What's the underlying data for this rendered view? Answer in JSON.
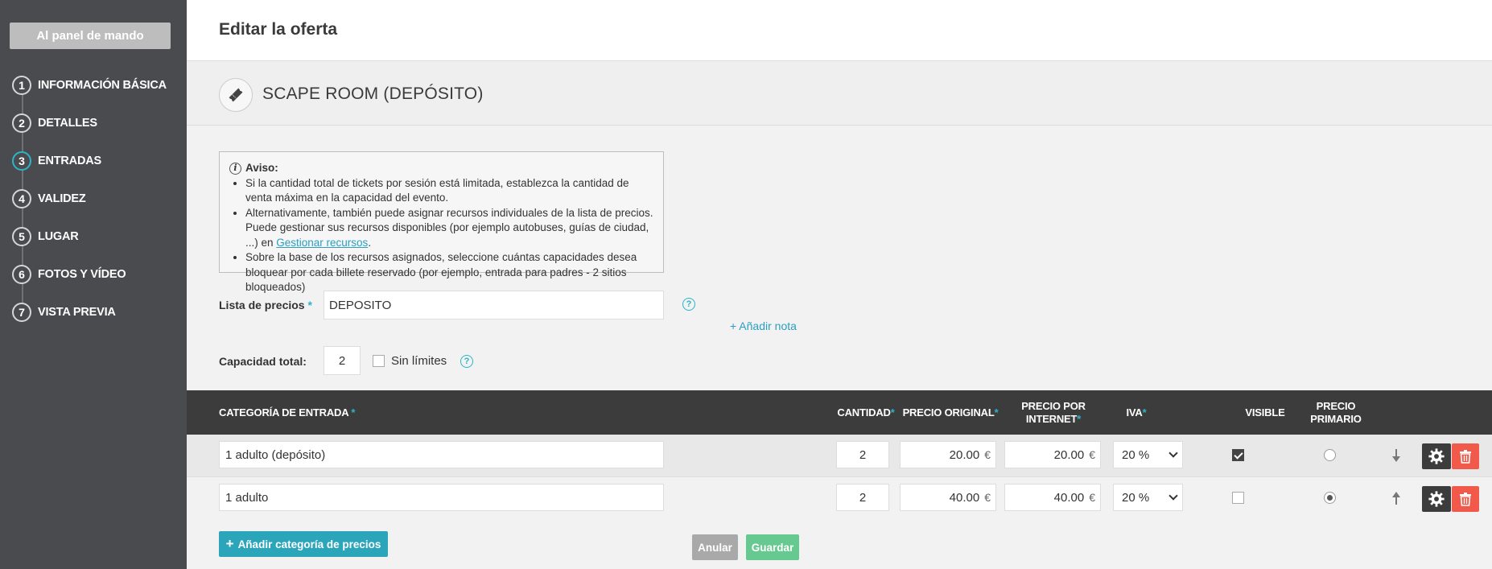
{
  "sidebar": {
    "dashboard_button": "Al panel de mando",
    "steps": [
      {
        "num": "1",
        "label": "INFORMACIÓN BÁSICA"
      },
      {
        "num": "2",
        "label": "DETALLES"
      },
      {
        "num": "3",
        "label": "ENTRADAS",
        "active": true
      },
      {
        "num": "4",
        "label": "VALIDEZ"
      },
      {
        "num": "5",
        "label": "LUGAR"
      },
      {
        "num": "6",
        "label": "FOTOS Y VÍDEO"
      },
      {
        "num": "7",
        "label": "VISTA PREVIA"
      }
    ]
  },
  "header": {
    "title": "Editar la oferta"
  },
  "offer": {
    "title": "SCAPE ROOM (DEPÓSITO)",
    "icon": "ticket-icon"
  },
  "notice": {
    "heading": "Aviso:",
    "item1": "Si la cantidad total de tickets por sesión está limitada, establezca la cantidad de venta máxima en la capacidad del evento.",
    "item2_text": "Alternativamente, también puede asignar recursos individuales de la lista de precios. Puede gestionar sus recursos disponibles (por ejemplo autobuses, guías de ciudad, ...) en ",
    "item2_link": "Gestionar recursos",
    "item2_end": ".",
    "item3": "Sobre la base de los recursos asignados, seleccione cuántas capacidades desea bloquear por cada billete reservado (por ejemplo, entrada para padres - 2 sitios bloqueados)"
  },
  "form": {
    "price_list_label": "Lista de precios",
    "price_list_value": "DEPOSITO",
    "add_note": "Añadir nota",
    "capacity_label": "Capacidad total:",
    "capacity_value": "2",
    "unlimited_label": "Sin límites",
    "required_mark": "*",
    "help_mark": "?"
  },
  "table": {
    "headers": {
      "category": "CATEGORÍA DE ENTRADA",
      "quantity": "CANTIDAD",
      "original_price": "PRECIO ORIGINAL",
      "internet_price_1": "PRECIO POR",
      "internet_price_2": "INTERNET",
      "vat": "IVA",
      "visible": "VISIBLE",
      "primary_1": "PRECIO",
      "primary_2": "PRIMARIO"
    },
    "currency": "€",
    "rows": [
      {
        "category": "1 adulto (depósito)",
        "quantity": "2",
        "original_price": "20.00",
        "internet_price": "20.00",
        "vat": "20 %",
        "visible": true,
        "primary": false
      },
      {
        "category": "1 adulto",
        "quantity": "2",
        "original_price": "40.00",
        "internet_price": "40.00",
        "vat": "20 %",
        "visible": false,
        "primary": true
      }
    ]
  },
  "actions": {
    "add_category": "Añadir categoría de precios",
    "cancel": "Anular",
    "save": "Guardar"
  },
  "colors": {
    "accent": "#2eb3c9",
    "sidebar": "#4a4b4f",
    "table_header": "#3c3c3c",
    "delete": "#f15a4b",
    "save": "#66c98f"
  }
}
